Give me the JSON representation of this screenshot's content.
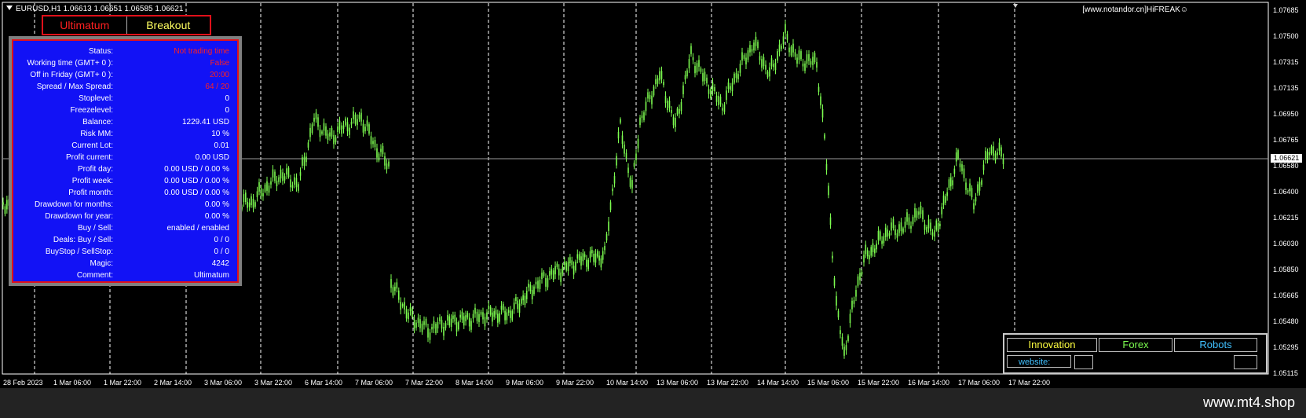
{
  "header": {
    "symbol_info": "EURUSD,H1  1.06613 1.06651 1.06585 1.06621",
    "brand": "[www.notandor.cn]HiFREAK☺"
  },
  "tabs": [
    {
      "label": "Ultimatum",
      "color": "#ff2020"
    },
    {
      "label": "Breakout",
      "color": "#ffff60"
    }
  ],
  "panel": {
    "rows": [
      {
        "label": "Status:",
        "value": "Not trading time",
        "alert": true
      },
      {
        "label": "Working time (GMT+ 0 ):",
        "value": "False",
        "alert": true
      },
      {
        "label": "Off in Friday (GMT+ 0 ):",
        "value": "20:00",
        "alert": true
      },
      {
        "label": "Spread / Max Spread:",
        "value": "64 / 20",
        "alert": true
      },
      {
        "label": "Stoplevel:",
        "value": "0",
        "alert": false
      },
      {
        "label": "Freezelevel:",
        "value": "0",
        "alert": false
      },
      {
        "label": "Balance:",
        "value": "1229.41 USD",
        "alert": false
      },
      {
        "label": "Risk MM:",
        "value": "10 %",
        "alert": false
      },
      {
        "label": "Current Lot:",
        "value": "0.01",
        "alert": false
      },
      {
        "label": "Profit current:",
        "value": "0.00 USD",
        "alert": false
      },
      {
        "label": "Profit day:",
        "value": "0.00 USD / 0.00 %",
        "alert": false
      },
      {
        "label": "Profit week:",
        "value": "0.00 USD / 0.00 %",
        "alert": false
      },
      {
        "label": "Profit month:",
        "value": "0.00 USD / 0.00 %",
        "alert": false
      },
      {
        "label": "Drawdown for months:",
        "value": "0.00 %",
        "alert": false
      },
      {
        "label": "Drawdown for year:",
        "value": "0.00 %",
        "alert": false
      },
      {
        "label": "Buy  /  Sell:",
        "value": "enabled  /  enabled",
        "alert": false
      },
      {
        "label": "Deals: Buy / Sell:",
        "value": "0  /  0",
        "alert": false
      },
      {
        "label": "BuyStop / SellStop:",
        "value": "0  /  0",
        "alert": false
      },
      {
        "label": "Magic:",
        "value": "4242",
        "alert": false
      },
      {
        "label": "Comment:",
        "value": "Ultimatum",
        "alert": false
      }
    ]
  },
  "price_axis": {
    "labels": [
      "1.07685",
      "1.07500",
      "1.07315",
      "1.07135",
      "1.06950",
      "1.06765",
      "1.06580",
      "1.06400",
      "1.06215",
      "1.06030",
      "1.05850",
      "1.05665",
      "1.05480",
      "1.05295",
      "1.05115"
    ],
    "current_price": "1.06621"
  },
  "time_axis": {
    "labels": [
      "28 Feb 2023",
      "1 Mar 06:00",
      "1 Mar 22:00",
      "2 Mar 14:00",
      "3 Mar 06:00",
      "3 Mar 22:00",
      "6 Mar 14:00",
      "7 Mar 06:00",
      "7 Mar 22:00",
      "8 Mar 14:00",
      "9 Mar 06:00",
      "9 Mar 22:00",
      "10 Mar 14:00",
      "13 Mar 06:00",
      "13 Mar 22:00",
      "14 Mar 14:00",
      "15 Mar 06:00",
      "15 Mar 22:00",
      "16 Mar 14:00",
      "17 Mar 06:00",
      "17 Mar 22:00"
    ]
  },
  "info_box": {
    "innovation": "Innovation",
    "forex": "Forex",
    "robots": "Robots",
    "website_label": "website:",
    "colors": {
      "innovation": "#ffff40",
      "forex": "#7cfc50",
      "robots": "#40c0ff",
      "website": "#40c0ff"
    }
  },
  "footer": {
    "site": "www.mt4.shop"
  },
  "colors": {
    "candle": "#7cfc50",
    "grid": "#ffffff",
    "accent_red": "#e0101a",
    "panel_blue": "#1212f5"
  }
}
